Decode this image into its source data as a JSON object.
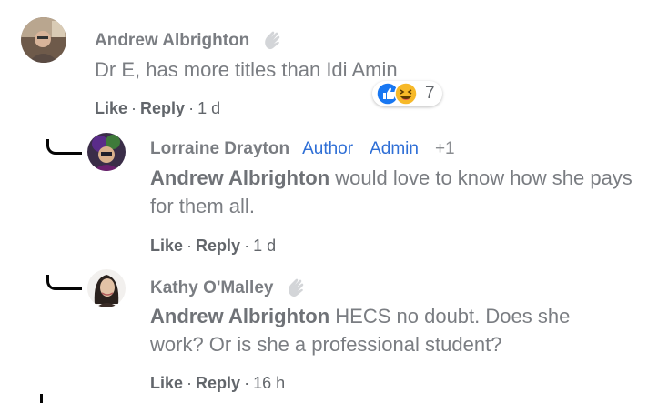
{
  "comments": [
    {
      "author": "Andrew Albrighton",
      "text": "Dr E, has more titles than Idi Amin",
      "actions": {
        "like": "Like",
        "reply": "Reply",
        "time": "1 d"
      },
      "reactions": {
        "icons": [
          "like-reaction",
          "haha-reaction"
        ],
        "count": "7"
      }
    }
  ],
  "replies": [
    {
      "author": "Lorraine Drayton",
      "badges": [
        "Author",
        "Admin"
      ],
      "extra": "+1",
      "mention": "Andrew Albrighton",
      "text": " would love to know how she pays for them all.",
      "actions": {
        "like": "Like",
        "reply": "Reply",
        "time": "1 d"
      }
    },
    {
      "author": "Kathy O'Malley",
      "mention": "Andrew Albrighton",
      "text": " HECS no doubt. Does she work? Or is she a professional student?",
      "actions": {
        "like": "Like",
        "reply": "Reply",
        "time": "16 h"
      }
    }
  ],
  "separator": "·",
  "colors": {
    "badge": "#2f6fd6",
    "like_reaction": "#1877f2",
    "haha_reaction": "#f7b928"
  }
}
